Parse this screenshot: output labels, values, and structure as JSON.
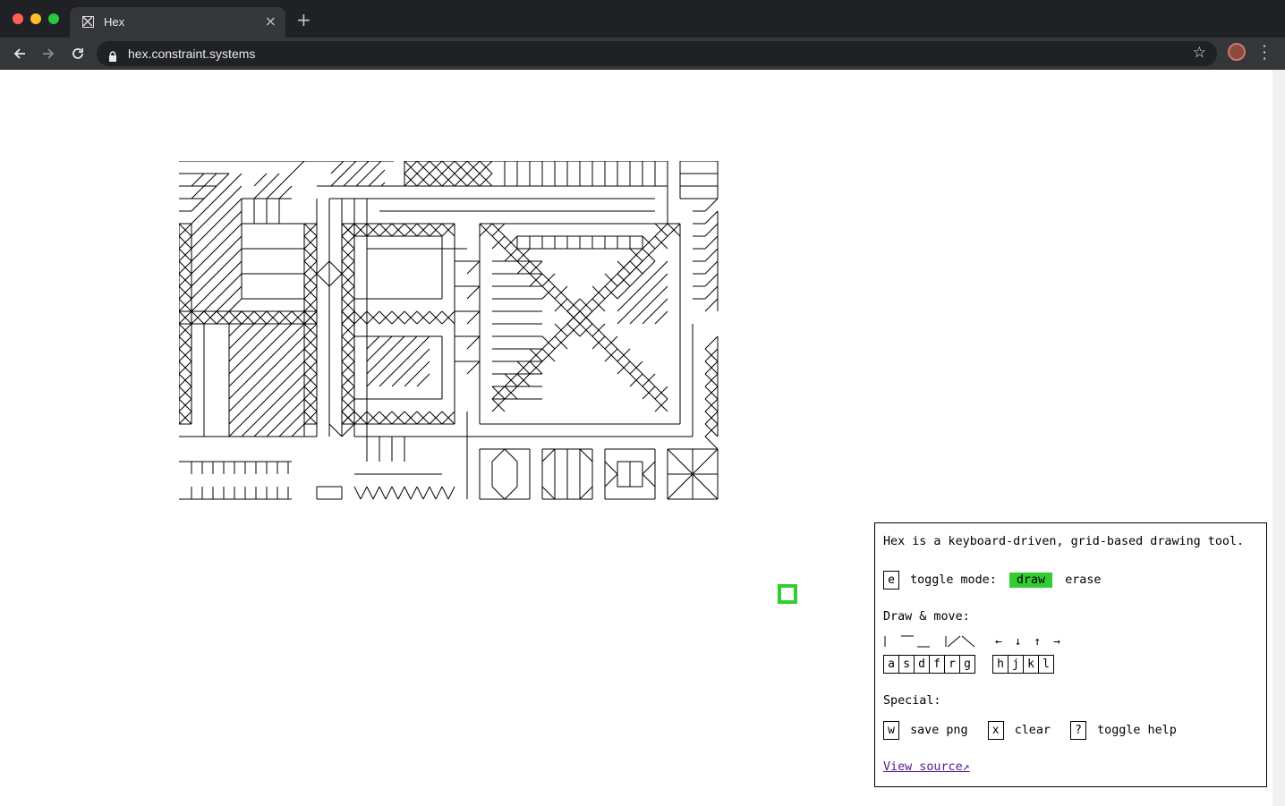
{
  "browser": {
    "tab_title": "Hex",
    "url": "hex.constraint.systems",
    "new_tab_label": "+",
    "tab_close_label": "×"
  },
  "help": {
    "intro": "Hex is a keyboard-driven, grid-based drawing tool.",
    "toggle_key": "e",
    "toggle_label": "toggle mode:",
    "mode_draw": "draw",
    "mode_erase": "erase",
    "draw_move_heading": "Draw & move:",
    "draw_keys": [
      "a",
      "s",
      "d",
      "f",
      "r",
      "g"
    ],
    "move_keys": [
      "h",
      "j",
      "k",
      "l"
    ],
    "move_arrows": "← ↓ ↑ →",
    "special_heading": "Special:",
    "save_key": "w",
    "save_label": "save png",
    "clear_key": "x",
    "clear_label": "clear",
    "help_key": "?",
    "help_label": "toggle help",
    "view_source": "View source↗"
  },
  "colors": {
    "cursor": "#33cc33",
    "draw_highlight": "#33cc33",
    "chrome_dark": "#202124",
    "link": "#551a8b"
  }
}
